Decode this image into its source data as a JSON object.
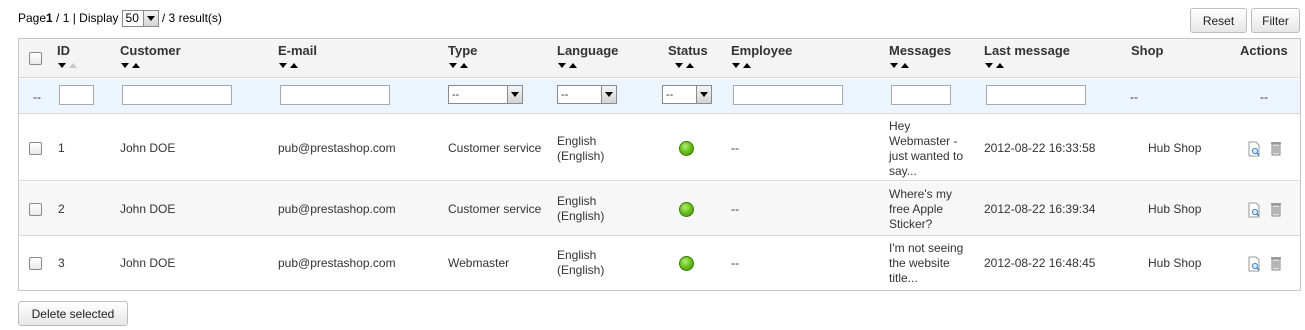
{
  "pagination": {
    "page_prefix": "Page",
    "current_page": "1",
    "page_sep": " / 1 | Display",
    "per_page": "50",
    "results": "/ 3 result(s)"
  },
  "toolbar": {
    "reset_label": "Reset",
    "filter_label": "Filter"
  },
  "columns": [
    {
      "label": "ID"
    },
    {
      "label": "Customer"
    },
    {
      "label": "E-mail"
    },
    {
      "label": "Type"
    },
    {
      "label": "Language"
    },
    {
      "label": "Status"
    },
    {
      "label": "Employee"
    },
    {
      "label": "Messages"
    },
    {
      "label": "Last message"
    },
    {
      "label": "Shop"
    },
    {
      "label": "Actions"
    }
  ],
  "filters": {
    "bulk_placeholder": "--",
    "type_value": "--",
    "language_value": "--",
    "status_value": "--",
    "shop_value": "--",
    "actions_value": "--"
  },
  "rows": [
    {
      "id": "1",
      "customer": "John DOE",
      "email": "pub@prestashop.com",
      "type": "Customer service",
      "language_1": "English",
      "language_2": "(English)",
      "status_color": "#6cc21e",
      "employee": "--",
      "message_lines": [
        "Hey",
        "Webmaster -",
        "just wanted to",
        "say..."
      ],
      "last_message": "2012-08-22 16:33:58",
      "shop": "Hub Shop"
    },
    {
      "id": "2",
      "customer": "John DOE",
      "email": "pub@prestashop.com",
      "type": "Customer service",
      "language_1": "English",
      "language_2": "(English)",
      "status_color": "#6cc21e",
      "employee": "--",
      "message_lines": [
        "Where's my",
        "free Apple",
        "Sticker?"
      ],
      "last_message": "2012-08-22 16:39:34",
      "shop": "Hub Shop"
    },
    {
      "id": "3",
      "customer": "John DOE",
      "email": "pub@prestashop.com",
      "type": "Webmaster",
      "language_1": "English",
      "language_2": "(English)",
      "status_color": "#6cc21e",
      "employee": "--",
      "message_lines": [
        "I'm not seeing",
        "the website",
        "title..."
      ],
      "last_message": "2012-08-22 16:48:45",
      "shop": "Hub Shop"
    }
  ],
  "bulk": {
    "delete_label": "Delete selected"
  },
  "icons": {
    "view": "view-icon",
    "delete": "delete-icon",
    "sort_desc": "sort-desc-icon",
    "sort_asc": "sort-asc-icon"
  }
}
